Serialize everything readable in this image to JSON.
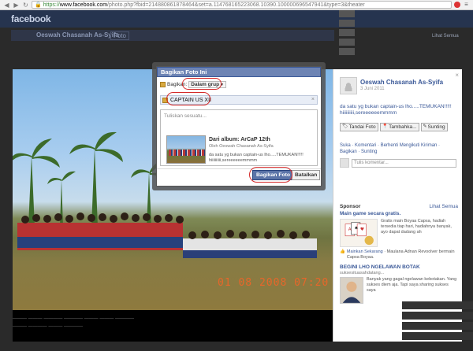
{
  "browser": {
    "url_scheme": "https://",
    "url_host": "www.facebook.com",
    "url_rest": "/photo.php?fbid=214880861878464&set=a.114768165223068.10390.100000696547941&type=3&theater"
  },
  "facebook": {
    "logo": "facebook",
    "profile_name": "Oeswah Chasanah As-Syifa",
    "tab_label": "Foto",
    "see_all": "Lihat Semua"
  },
  "photo": {
    "date_stamp": "01 08 2008 07:20"
  },
  "side": {
    "owner_name": "Oeswah Chasanah As-Syifa",
    "owner_date": "3 Juni 2011",
    "caption": "da satu yg bukan captain-us lho.....TEMUKAN!!!!! hiiiiiiiiii,sereeeeeemmmm",
    "tag_buttons": [
      {
        "icon": "tag-icon",
        "label": "Tandai Foto"
      },
      {
        "icon": "pin-icon",
        "label": "Tambahka..."
      },
      {
        "icon": "pencil-icon",
        "label": "Sunting"
      }
    ],
    "actions": "Suka · Komentari · Berhenti Mengikuti Kiriman · Bagikan · Sunting",
    "comment_placeholder": "Tulis komentar...",
    "sponsor_title": "Sponsor",
    "sponsor_all": "Lihat Semua",
    "ad1": {
      "title": "Main game secara gratis.",
      "text": "Gratis main Boyaa Capsa, hadiah tersedia tiap hari, hadiahnya banyak, ayo dapat dadang ah",
      "like_link": "Mainkan Sekarang",
      "like_text": "Maulana Adnan Revoolver bermain Capsa Boyaa."
    },
    "ad2": {
      "title": "BEGINI LHO NGELAWAN BOTAK",
      "url": "suksesituasahdatang...",
      "text": "Banyak yang gagal ngelawan kebotakan. Yang sukses diem aja. Tapi saya sharing sukses saya"
    }
  },
  "dialog": {
    "title": "Bagikan Foto Ini",
    "share_label": "Bagikan:",
    "share_target": "Dalam grup",
    "group_value": "CAPTAIN US XII",
    "compose_placeholder": "Tuliskan sesuatu...",
    "attach_prefix": "Dari album:",
    "attach_album": "ArCaP 12th",
    "attach_by": "Oleh Oeswah Chasanah As-Syifa",
    "attach_desc": "da satu yg bukan captain-us lho.....TEMUKAN!!!!! hiiiiiiiiii,sereeeeeemmmm",
    "share_button": "Bagikan Foto",
    "cancel_button": "Batalkan"
  },
  "colors": {
    "fb_blue": "#3b5998",
    "dialog_title_bg": "#6d84b4",
    "annotation_ring": "#d42a2a",
    "date_stamp": "#e8662a"
  }
}
